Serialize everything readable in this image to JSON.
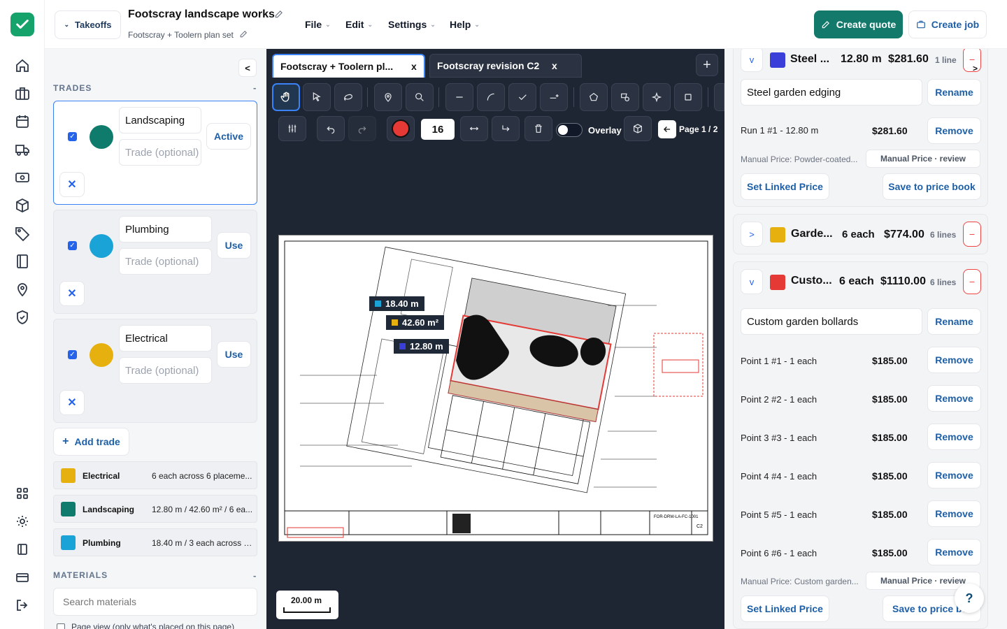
{
  "header": {
    "takeoffs_label": "Takeoffs",
    "project_title": "Footscray landscape works",
    "plan_set": "Footscray + Toolern plan set",
    "menus": [
      "File",
      "Edit",
      "Settings",
      "Help"
    ],
    "create_quote": "Create quote",
    "create_job": "Create job"
  },
  "left": {
    "collapse_label": "<",
    "trades_heading": "TRADES",
    "trades_toggle": "-",
    "trades": [
      {
        "name": "Landscaping",
        "placeholder": "Trade (optional)",
        "button": "Active",
        "color": "#0f7b6c"
      },
      {
        "name": "Plumbing",
        "placeholder": "Trade (optional)",
        "button": "Use",
        "color": "#1aa3d6"
      },
      {
        "name": "Electrical",
        "placeholder": "Trade (optional)",
        "button": "Use",
        "color": "#e6b10e"
      }
    ],
    "add_trade": "Add trade",
    "summaries": [
      {
        "name": "Electrical",
        "desc": "6 each across 6 placeme...",
        "color": "#e6b10e"
      },
      {
        "name": "Landscaping",
        "desc": "12.80 m / 42.60 m² / 6 ea...",
        "color": "#0f7b6c"
      },
      {
        "name": "Plumbing",
        "desc": "18.40 m / 3 each across 1...",
        "color": "#1aa3d6"
      }
    ],
    "materials_heading": "MATERIALS",
    "materials_toggle": "-",
    "search_placeholder": "Search materials",
    "page_view_label": "Page view (only what's placed on this page)"
  },
  "center": {
    "tabs": [
      {
        "label": "Footscray + Toolern pl...",
        "close": "x"
      },
      {
        "label": "Footscray revision C2",
        "close": "x"
      }
    ],
    "add_tab": "+",
    "stroke_width": "16",
    "overlay_label": "Overlay",
    "page_label": "Page 1 / 2",
    "measure_labels": [
      {
        "text": "18.40 m",
        "color": "#1aa3d6"
      },
      {
        "text": "42.60 m²",
        "color": "#e6b10e"
      },
      {
        "text": "12.80 m",
        "color": "#3b3fd9"
      }
    ],
    "scale_label": "20.00 m",
    "drawing_number": "FOR-DRW-LA-FC-1001",
    "drawing_rev": "C2",
    "colors": {
      "canvas": "#1f2633",
      "active_color": "#e53935"
    }
  },
  "right": {
    "steel": {
      "toggle": "v",
      "name": "Steel ...",
      "qty": "12.80 m",
      "price": "$281.60",
      "lines": "1 line",
      "color": "#3b3fd9",
      "rename_value": "Steel garden edging",
      "rename": "Rename",
      "run": "Run 1 #1 - 12.80 m",
      "run_price": "$281.60",
      "remove": "Remove",
      "manual": "Manual Price: Powder-coated...",
      "manual_badge": "Manual Price · review",
      "set_linked": "Set Linked Price",
      "save_book": "Save to price book",
      "next_arrow": ">"
    },
    "garden": {
      "toggle": ">",
      "name": "Garde...",
      "qty": "6 each",
      "price": "$774.00",
      "lines": "6 lines",
      "color": "#e6b10e"
    },
    "custom": {
      "toggle": "v",
      "name": "Custo...",
      "qty": "6 each",
      "price": "$1110.00",
      "lines": "6 lines",
      "color": "#e53935",
      "rename_value": "Custom garden bollards",
      "rename": "Rename",
      "points": [
        {
          "label": "Point 1 #1 - 1 each",
          "price": "$185.00"
        },
        {
          "label": "Point 2 #2 - 1 each",
          "price": "$185.00"
        },
        {
          "label": "Point 3 #3 - 1 each",
          "price": "$185.00"
        },
        {
          "label": "Point 4 #4 - 1 each",
          "price": "$185.00"
        },
        {
          "label": "Point 5 #5 - 1 each",
          "price": "$185.00"
        },
        {
          "label": "Point 6 #6 - 1 each",
          "price": "$185.00"
        }
      ],
      "remove": "Remove",
      "manual": "Manual Price: Custom garden...",
      "manual_badge": "Manual Price · review",
      "set_linked": "Set Linked Price",
      "save_book": "Save to price boo"
    },
    "minus": "−",
    "help": "?"
  },
  "brand": {
    "accent": "#137a6b",
    "link": "#1d5fa8"
  }
}
